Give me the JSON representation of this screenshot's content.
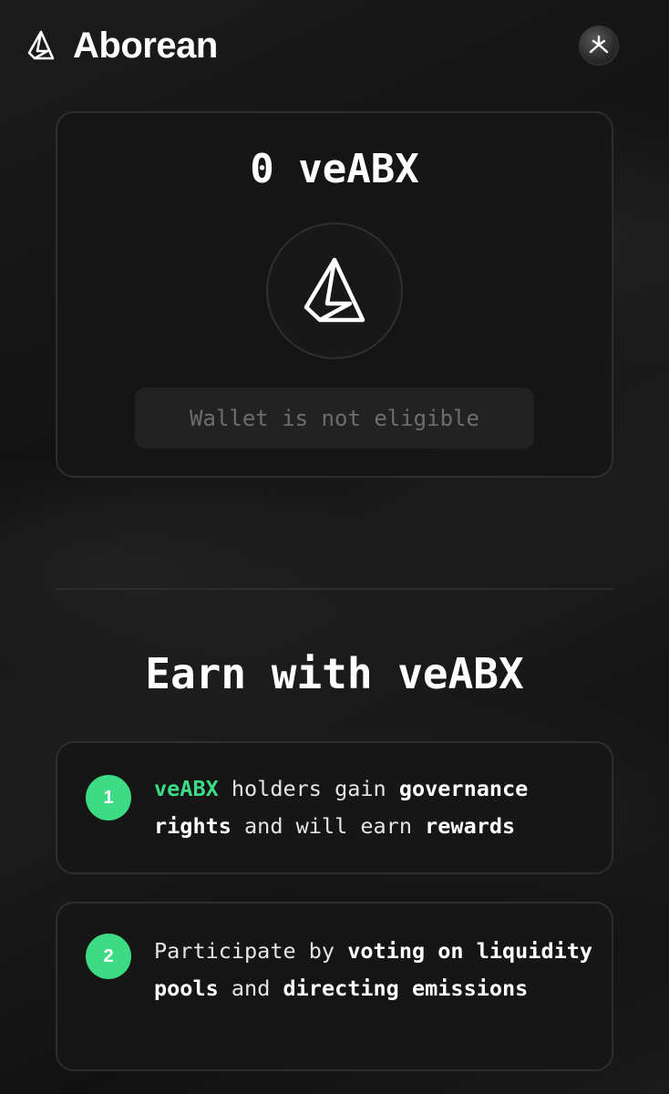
{
  "header": {
    "logo_icon": "aborean-logo-icon",
    "brand_name": "Aborean",
    "wallet_avatar_icon": "wallet-avatar-icon"
  },
  "balance_card": {
    "amount_text": "0 veABX",
    "token_icon": "veabx-token-icon",
    "eligibility_button_label": "Wallet is not eligible"
  },
  "earn_section": {
    "title": "Earn with veABX",
    "steps": [
      {
        "number": "1",
        "parts": [
          "veABX",
          " holders gain ",
          "governance rights",
          " and will earn ",
          "rewards"
        ]
      },
      {
        "number": "2",
        "parts": [
          "Participate by ",
          "voting on liquidity pools",
          " and ",
          "directing emissions"
        ]
      }
    ]
  },
  "colors": {
    "accent_green": "#3ddc84",
    "background": "#161616",
    "card_border": "#2e2e2e",
    "disabled_text": "#6d6d6d"
  }
}
